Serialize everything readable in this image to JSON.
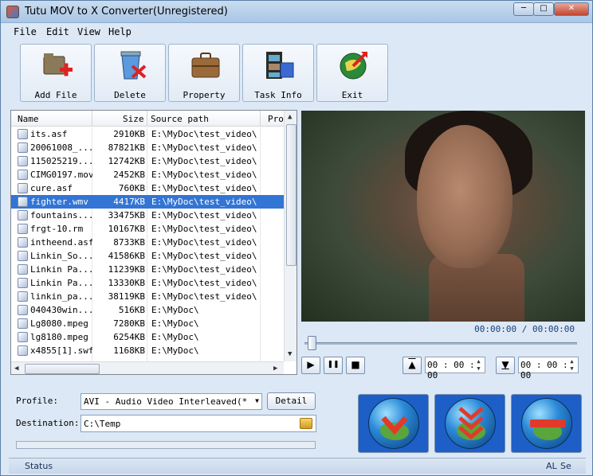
{
  "window": {
    "title": "Tutu MOV to X Converter(Unregistered)",
    "min_glyph": "─",
    "max_glyph": "□",
    "close_glyph": "✕"
  },
  "menu": [
    {
      "label": "File"
    },
    {
      "label": "Edit"
    },
    {
      "label": "View"
    },
    {
      "label": "Help"
    }
  ],
  "toolbar": [
    {
      "label": "Add File",
      "icon": "add-file-icon"
    },
    {
      "label": "Delete",
      "icon": "recycle-bin-icon"
    },
    {
      "label": "Property",
      "icon": "briefcase-icon"
    },
    {
      "label": "Task Info",
      "icon": "film-strip-icon"
    },
    {
      "label": "Exit",
      "icon": "exit-globe-icon"
    }
  ],
  "file_list": {
    "columns": [
      "Name",
      "Size",
      "Source path",
      "Pro"
    ],
    "rows": [
      {
        "name": "its.asf",
        "size": "2910KB",
        "path": "E:\\MyDoc\\test_video\\",
        "selected": false
      },
      {
        "name": "20061008_...",
        "size": "87821KB",
        "path": "E:\\MyDoc\\test_video\\",
        "selected": false
      },
      {
        "name": "115025219....",
        "size": "12742KB",
        "path": "E:\\MyDoc\\test_video\\",
        "selected": false
      },
      {
        "name": "CIMG0197.mov",
        "size": "2452KB",
        "path": "E:\\MyDoc\\test_video\\",
        "selected": false
      },
      {
        "name": "cure.asf",
        "size": "760KB",
        "path": "E:\\MyDoc\\test_video\\",
        "selected": false
      },
      {
        "name": "fighter.wmv",
        "size": "4417KB",
        "path": "E:\\MyDoc\\test_video\\",
        "selected": true
      },
      {
        "name": "fountains....",
        "size": "33475KB",
        "path": "E:\\MyDoc\\test_video\\",
        "selected": false
      },
      {
        "name": "frgt-10.rm",
        "size": "10167KB",
        "path": "E:\\MyDoc\\test_video\\",
        "selected": false
      },
      {
        "name": "intheend.asf",
        "size": "8733KB",
        "path": "E:\\MyDoc\\test_video\\",
        "selected": false
      },
      {
        "name": "Linkin_So...",
        "size": "41586KB",
        "path": "E:\\MyDoc\\test_video\\",
        "selected": false
      },
      {
        "name": "Linkin Pa...",
        "size": "11239KB",
        "path": "E:\\MyDoc\\test_video\\",
        "selected": false
      },
      {
        "name": "Linkin Pa...",
        "size": "13330KB",
        "path": "E:\\MyDoc\\test_video\\",
        "selected": false
      },
      {
        "name": "linkin_pa...",
        "size": "38119KB",
        "path": "E:\\MyDoc\\test_video\\",
        "selected": false
      },
      {
        "name": "040430win...",
        "size": "516KB",
        "path": "E:\\MyDoc\\",
        "selected": false
      },
      {
        "name": "Lg8080.mpeg",
        "size": "7280KB",
        "path": "E:\\MyDoc\\",
        "selected": false
      },
      {
        "name": "lg8180.mpeg",
        "size": "6254KB",
        "path": "E:\\MyDoc\\",
        "selected": false
      },
      {
        "name": "x4855[1].swf",
        "size": "1168KB",
        "path": "E:\\MyDoc\\",
        "selected": false
      }
    ],
    "scroll_up": "▲",
    "scroll_down": "▼",
    "scroll_left": "◀",
    "scroll_right": "▶"
  },
  "player": {
    "time_display": "00:00:00 / 00:00:00",
    "seek_position": 0,
    "play_glyph": "▶",
    "pause_glyph": "❚❚",
    "stop_glyph": "■",
    "set_start_glyph": "▲",
    "set_end_glyph": "▼",
    "start_time": "00 : 00 : 00",
    "end_time": "00 : 00 : 00",
    "spin_up": "▲",
    "spin_down": "▼"
  },
  "settings": {
    "profile_label": "Profile:",
    "profile_value": "AVI - Audio Video Interleaved(*.avi)",
    "profile_arrow": "▼",
    "detail_label": "Detail",
    "destination_label": "Destination:",
    "destination_value": "C:\\Temp",
    "progress": 0
  },
  "convert_buttons": [
    {
      "icon": "convert-globe-icon"
    },
    {
      "icon": "batch-convert-globe-icon"
    },
    {
      "icon": "stop-convert-globe-icon"
    }
  ],
  "statusbar": {
    "status": "Status",
    "right_1": "AL",
    "right_2": "Se"
  },
  "colors": {
    "selection": "#3375d4",
    "convert_button_bg": "#1d5fc6",
    "time_text": "#1a3f7a"
  }
}
